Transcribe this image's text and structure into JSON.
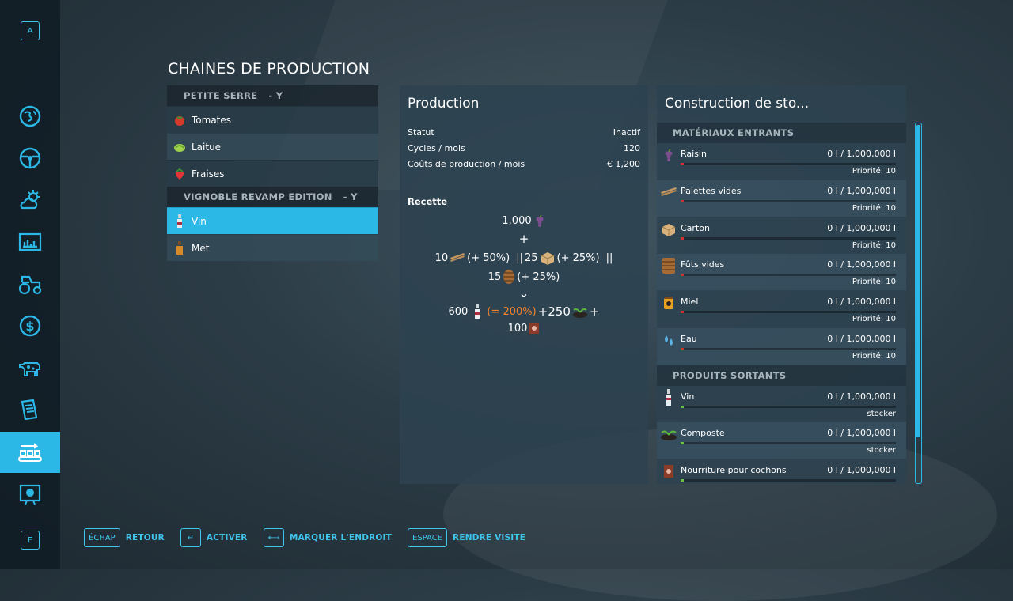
{
  "sidebar": {
    "top_key": "A",
    "bottom_key": "E",
    "items": [
      {
        "icon": "map-icon"
      },
      {
        "icon": "steering-wheel-icon"
      },
      {
        "icon": "weather-icon"
      },
      {
        "icon": "statistics-icon"
      },
      {
        "icon": "tractor-icon"
      },
      {
        "icon": "finance-icon"
      },
      {
        "icon": "animals-icon"
      },
      {
        "icon": "contracts-icon"
      },
      {
        "icon": "production-icon",
        "active": true
      },
      {
        "icon": "help-icon"
      }
    ]
  },
  "page_title": "CHAINES DE PRODUCTION",
  "groups": [
    {
      "name": "PETITE SERRE",
      "sep": "- Y",
      "items": [
        {
          "label": "Tomates",
          "icon": "tomato-icon"
        },
        {
          "label": "Laitue",
          "icon": "lettuce-icon"
        },
        {
          "label": "Fraises",
          "icon": "strawberry-icon"
        }
      ]
    },
    {
      "name": "VIGNOBLE REVAMP EDITION",
      "sep": "- Y",
      "items": [
        {
          "label": "Vin",
          "icon": "wine-icon",
          "selected": true
        },
        {
          "label": "Met",
          "icon": "mead-icon"
        }
      ]
    }
  ],
  "production": {
    "title": "Production",
    "stats": [
      {
        "label": "Statut",
        "value": "Inactif"
      },
      {
        "label": "Cycles / mois",
        "value": "120"
      },
      {
        "label": "Coûts de production / mois",
        "value": "€ 1,200"
      }
    ],
    "recipe_label": "Recette",
    "recipe": {
      "line1_amount": "1,000",
      "plus": "+",
      "line2_a": "10",
      "line2_a_pct": "(+ 50%)",
      "sep": "||",
      "line2_b": "25",
      "line2_b_pct": "(+ 25%)",
      "line3_amount": "15",
      "line3_pct": "(+ 25%)",
      "arrow": "⌄",
      "out1": "600",
      "out1_pct": "(= 200%)",
      "out2": "+250",
      "out2_plus": "+",
      "out3": "100"
    }
  },
  "storage": {
    "title": "Construction de sto...",
    "inputs_header": "MATÉRIAUX ENTRANTS",
    "outputs_header": "PRODUITS SORTANTS",
    "inputs": [
      {
        "name": "Raisin",
        "amount": "0 l / 1,000,000 l",
        "sub": "Priorité: 10",
        "icon": "grapes-icon",
        "fill": 0
      },
      {
        "name": "Palettes vides",
        "amount": "0 l / 1,000,000 l",
        "sub": "Priorité: 10",
        "icon": "pallet-icon",
        "fill": 0
      },
      {
        "name": "Carton",
        "amount": "0 l / 1,000,000 l",
        "sub": "Priorité: 10",
        "icon": "cardboard-icon",
        "fill": 0
      },
      {
        "name": "Fûts vides",
        "amount": "0 l / 1,000,000 l",
        "sub": "Priorité: 10",
        "icon": "barrel-icon",
        "fill": 0
      },
      {
        "name": "Miel",
        "amount": "0 l / 1,000,000 l",
        "sub": "Priorité: 10",
        "icon": "honey-icon",
        "fill": 0
      },
      {
        "name": "Eau",
        "amount": "0 l / 1,000,000 l",
        "sub": "Priorité: 10",
        "icon": "water-icon",
        "fill": 0
      }
    ],
    "outputs": [
      {
        "name": "Vin",
        "amount": "0 l / 1,000,000 l",
        "sub": "stocker",
        "icon": "wine-icon",
        "fill": 0
      },
      {
        "name": "Composte",
        "amount": "0 l / 1,000,000 l",
        "sub": "stocker",
        "icon": "compost-icon",
        "fill": 0
      },
      {
        "name": "Nourriture pour cochons",
        "amount": "0 l / 1,000,000 l",
        "sub": "",
        "icon": "pig-food-icon",
        "fill": 0
      }
    ],
    "colors": {
      "input_bar": "#d0312d",
      "output_bar": "#6cc04a"
    }
  },
  "bottom_bar": [
    {
      "key": "ÉCHAP",
      "label": "RETOUR"
    },
    {
      "key": "↵",
      "label": "ACTIVER"
    },
    {
      "key": "⟻",
      "label": "MARQUER L'ENDROIT"
    },
    {
      "key": "ESPACE",
      "label": "RENDRE VISITE"
    }
  ],
  "colors": {
    "accent": "#2bb8e6",
    "orange": "#f0822e"
  }
}
